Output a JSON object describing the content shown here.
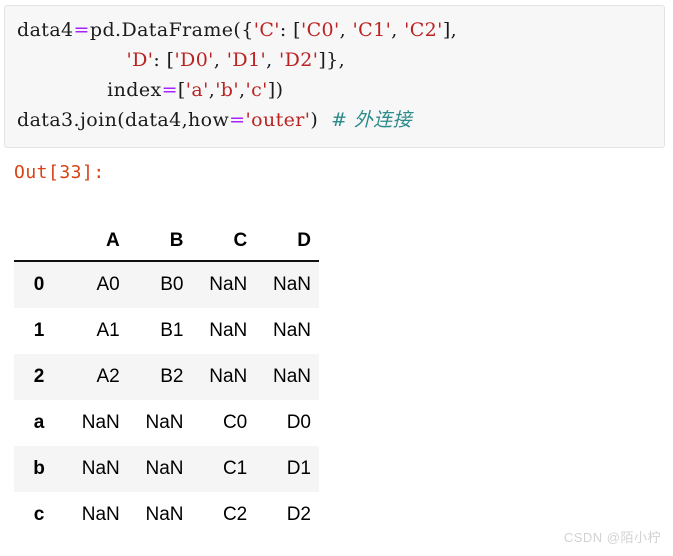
{
  "code_cell": {
    "lines": [
      [
        {
          "t": "plain",
          "v": "data4"
        },
        {
          "t": "op",
          "v": "="
        },
        {
          "t": "plain",
          "v": "pd.DataFrame({"
        },
        {
          "t": "str",
          "v": "'C'"
        },
        {
          "t": "punc",
          "v": ": ["
        },
        {
          "t": "str",
          "v": "'C0'"
        },
        {
          "t": "punc",
          "v": ", "
        },
        {
          "t": "str",
          "v": "'C1'"
        },
        {
          "t": "punc",
          "v": ", "
        },
        {
          "t": "str",
          "v": "'C2'"
        },
        {
          "t": "punc",
          "v": "],"
        }
      ],
      [
        {
          "t": "punc",
          "v": "                 "
        },
        {
          "t": "str",
          "v": "'D'"
        },
        {
          "t": "punc",
          "v": ": ["
        },
        {
          "t": "str",
          "v": "'D0'"
        },
        {
          "t": "punc",
          "v": ", "
        },
        {
          "t": "str",
          "v": "'D1'"
        },
        {
          "t": "punc",
          "v": ", "
        },
        {
          "t": "str",
          "v": "'D2'"
        },
        {
          "t": "punc",
          "v": "]},"
        }
      ],
      [
        {
          "t": "punc",
          "v": "              "
        },
        {
          "t": "plain",
          "v": "index"
        },
        {
          "t": "op",
          "v": "="
        },
        {
          "t": "punc",
          "v": "["
        },
        {
          "t": "str",
          "v": "'a'"
        },
        {
          "t": "punc",
          "v": ","
        },
        {
          "t": "str",
          "v": "'b'"
        },
        {
          "t": "punc",
          "v": ","
        },
        {
          "t": "str",
          "v": "'c'"
        },
        {
          "t": "punc",
          "v": "])"
        }
      ],
      [
        {
          "t": "plain",
          "v": "data3.join(data4,how"
        },
        {
          "t": "op",
          "v": "="
        },
        {
          "t": "str",
          "v": "'outer'"
        },
        {
          "t": "punc",
          "v": ")  "
        },
        {
          "t": "comment",
          "v": "# 外连接"
        }
      ]
    ]
  },
  "output": {
    "prompt": "Out[33]:"
  },
  "dataframe": {
    "index_header": "",
    "columns": [
      "A",
      "B",
      "C",
      "D"
    ],
    "rows": [
      {
        "index": "0",
        "cells": [
          "A0",
          "B0",
          "NaN",
          "NaN"
        ]
      },
      {
        "index": "1",
        "cells": [
          "A1",
          "B1",
          "NaN",
          "NaN"
        ]
      },
      {
        "index": "2",
        "cells": [
          "A2",
          "B2",
          "NaN",
          "NaN"
        ]
      },
      {
        "index": "a",
        "cells": [
          "NaN",
          "NaN",
          "C0",
          "D0"
        ]
      },
      {
        "index": "b",
        "cells": [
          "NaN",
          "NaN",
          "C1",
          "D1"
        ]
      },
      {
        "index": "c",
        "cells": [
          "NaN",
          "NaN",
          "C2",
          "D2"
        ]
      }
    ]
  },
  "watermark": {
    "text": "CSDN @陌小柠"
  },
  "colors": {
    "cell_background": "#f7f7f7",
    "cell_border": "#e3e3e3",
    "operator": "#aa22ff",
    "string": "#bb2222",
    "comment": "#2e8b8b",
    "prompt": "#d84315",
    "stripe": "#f5f5f5",
    "watermark": "#d2d2d2"
  }
}
